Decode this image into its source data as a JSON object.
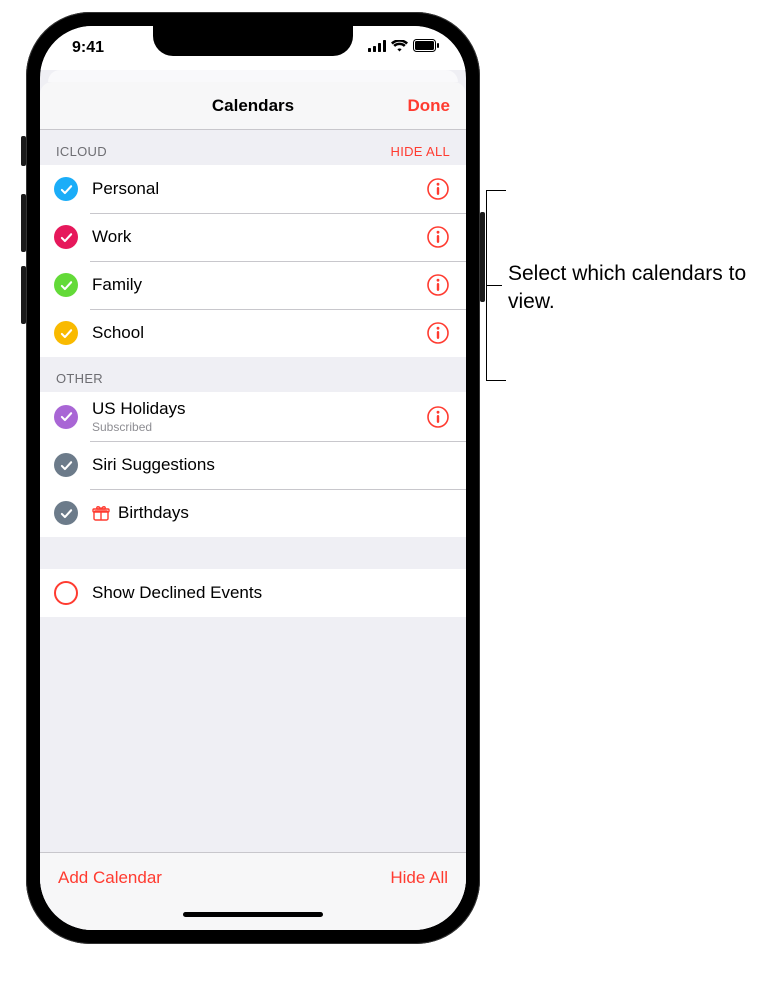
{
  "status": {
    "time": "9:41"
  },
  "nav": {
    "title": "Calendars",
    "done": "Done"
  },
  "sections": [
    {
      "name": "ICLOUD",
      "action": "HIDE ALL",
      "items": [
        {
          "label": "Personal",
          "color": "#1badf8",
          "checked": true,
          "info": true
        },
        {
          "label": "Work",
          "color": "#e6185b",
          "checked": true,
          "info": true
        },
        {
          "label": "Family",
          "color": "#63da38",
          "checked": true,
          "info": true
        },
        {
          "label": "School",
          "color": "#f9ba00",
          "checked": true,
          "info": true
        }
      ]
    },
    {
      "name": "OTHER",
      "items": [
        {
          "label": "US Holidays",
          "sub": "Subscribed",
          "color": "#a966d5",
          "checked": true,
          "info": true
        },
        {
          "label": "Siri Suggestions",
          "color": "#6c7b8a",
          "checked": true,
          "info": false
        },
        {
          "label": "Birthdays",
          "color": "#6c7b8a",
          "checked": true,
          "info": false,
          "icon": "gift",
          "icon_color": "#ff3b30"
        }
      ]
    }
  ],
  "declined": {
    "label": "Show Declined Events",
    "checked": false
  },
  "toolbar": {
    "add": "Add Calendar",
    "hide": "Hide All"
  },
  "callout": "Select which calendars to view.",
  "colors": {
    "accent": "#ff3b30"
  }
}
